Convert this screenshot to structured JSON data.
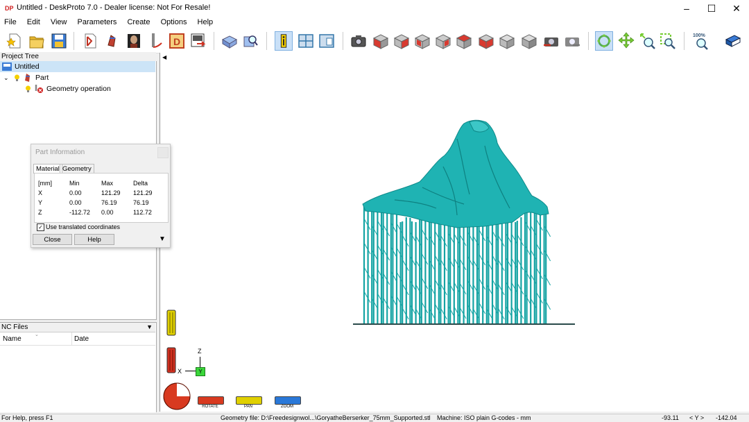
{
  "window": {
    "title": "Untitled - DeskProto 7.0 - Dealer license: Not For Resale!",
    "app_icon_text": "DP",
    "controls": [
      "–",
      "☐",
      "✕"
    ]
  },
  "menu": [
    "File",
    "Edit",
    "View",
    "Parameters",
    "Create",
    "Options",
    "Help"
  ],
  "toolbar": {
    "zoom_label": "100%"
  },
  "project_tree": {
    "header": "Project Tree",
    "root": "Untitled",
    "part": "Part",
    "operation": "Geometry operation"
  },
  "nc_files": {
    "header": "NC Files",
    "col_name": "Name",
    "col_date": "Date"
  },
  "part_info": {
    "title": "Part Information",
    "tabs": [
      "Material",
      "Geometry"
    ],
    "headers": [
      "[mm]",
      "Min",
      "Max",
      "Delta"
    ],
    "rows": [
      {
        "axis": "X",
        "min": "0.00",
        "max": "121.29",
        "delta": "121.29"
      },
      {
        "axis": "Y",
        "min": "0.00",
        "max": "76.19",
        "delta": "76.19"
      },
      {
        "axis": "Z",
        "min": "-112.72",
        "max": "0.00",
        "delta": "112.72"
      }
    ],
    "checkbox_label": "Use translated coordinates",
    "checkbox_checked": true,
    "close_label": "Close",
    "help_label": "Help"
  },
  "viewport": {
    "axis_z": "Z",
    "axis_x": "X",
    "axis_y": "Y",
    "legend": [
      "ROTATE",
      "PAN",
      "ZOOM"
    ],
    "model_color": "#1fb3b3"
  },
  "status": {
    "help": "For Help, press F1",
    "geometry": "Geometry file: D:\\Freedesignwol...\\GoryatheBerserker_75mm_Supported.stl",
    "machine": "Machine: ISO plain G-codes - mm",
    "x": "-93.11",
    "y_label": "< Y >",
    "y": "-142.04"
  }
}
